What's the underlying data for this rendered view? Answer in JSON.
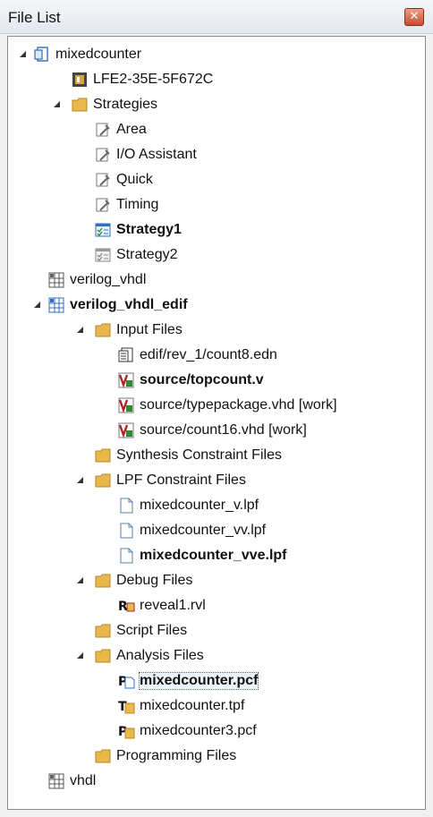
{
  "panel": {
    "title": "File List"
  },
  "tree": {
    "root": "mixedcounter",
    "device": "LFE2-35E-5F672C",
    "strategies": {
      "label": "Strategies",
      "items": [
        "Area",
        "I/O Assistant",
        "Quick",
        "Timing",
        "Strategy1",
        "Strategy2"
      ]
    },
    "impl1": "verilog_vhdl",
    "impl2": {
      "label": "verilog_vhdl_edif",
      "input_files": {
        "label": "Input Files",
        "items": [
          "edif/rev_1/count8.edn",
          "source/topcount.v",
          "source/typepackage.vhd [work]",
          "source/count16.vhd [work]"
        ]
      },
      "synthesis": "Synthesis Constraint Files",
      "lpf": {
        "label": "LPF Constraint Files",
        "items": [
          "mixedcounter_v.lpf",
          "mixedcounter_vv.lpf",
          "mixedcounter_vve.lpf"
        ]
      },
      "debug": {
        "label": "Debug Files",
        "items": [
          "reveal1.rvl"
        ]
      },
      "script": "Script Files",
      "analysis": {
        "label": "Analysis Files",
        "items": [
          "mixedcounter.pcf",
          "mixedcounter.tpf",
          "mixedcounter3.pcf"
        ]
      },
      "programming": "Programming Files"
    },
    "impl3": "vhdl"
  },
  "colors": {
    "folder": "#e8b84a",
    "strategy_blue": "#2f6fbf",
    "verilog_red": "#b22222",
    "verilog_green": "#2e8b2e"
  },
  "icons": [
    "project-icon",
    "chip-icon",
    "folder-icon",
    "strategy-wrench-icon",
    "strategy-active-icon",
    "strategy-inactive-icon",
    "implementation-icon",
    "edif-file-icon",
    "hdl-file-icon",
    "lpf-file-icon",
    "reveal-file-icon",
    "pcf-file-icon",
    "tpf-file-icon"
  ]
}
